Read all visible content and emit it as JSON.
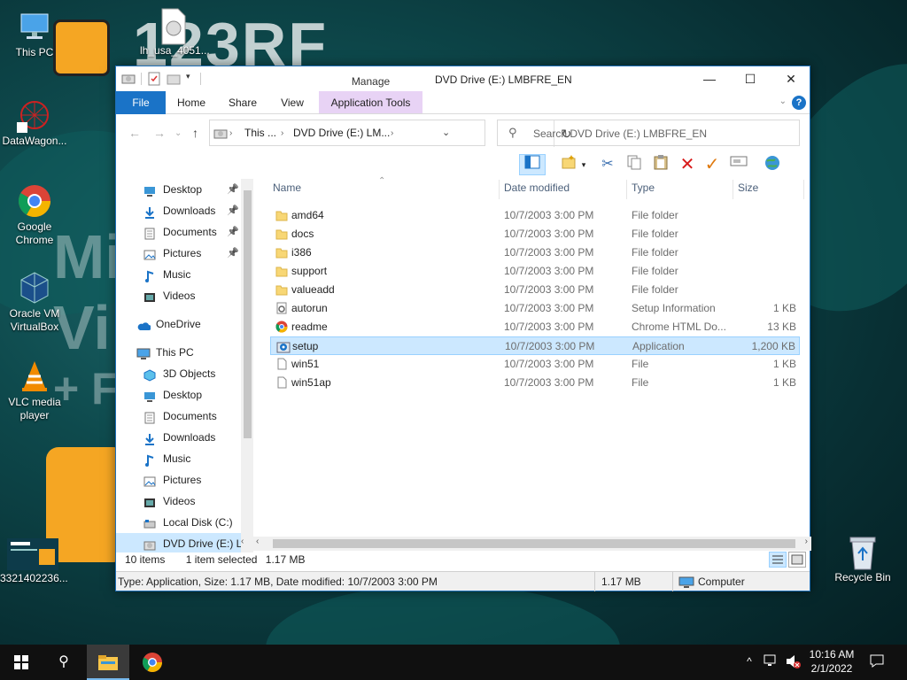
{
  "desktop": {
    "icons": [
      {
        "label": "This PC"
      },
      {
        "label": "lh_usa_4051..."
      },
      {
        "label": "DataWagon..."
      },
      {
        "label": "Google Chrome"
      },
      {
        "label": "Oracle VM VirtualBox"
      },
      {
        "label": "VLC media player"
      },
      {
        "label": "3321402236..."
      },
      {
        "label": "Recycle Bin"
      }
    ]
  },
  "window": {
    "title": "DVD Drive (E:) LMBFRE_EN",
    "context_tab_group": "Manage",
    "ribbon_tabs": [
      "File",
      "Home",
      "Share",
      "View",
      "Application Tools"
    ],
    "controls": {
      "minimize": "—",
      "maximize": "☐",
      "close": "✕"
    },
    "help": "?"
  },
  "address": {
    "crumbs": [
      "This ...",
      "DVD Drive (E:) LM..."
    ],
    "search_placeholder": "Search DVD Drive (E:) LMBFRE_EN"
  },
  "nav_pane": {
    "quick_access": [
      {
        "label": "Desktop",
        "pinned": true
      },
      {
        "label": "Downloads",
        "pinned": true
      },
      {
        "label": "Documents",
        "pinned": true
      },
      {
        "label": "Pictures",
        "pinned": true
      },
      {
        "label": "Music",
        "pinned": false
      },
      {
        "label": "Videos",
        "pinned": false
      }
    ],
    "onedrive": "OneDrive",
    "this_pc": "This PC",
    "this_pc_items": [
      "3D Objects",
      "Desktop",
      "Documents",
      "Downloads",
      "Music",
      "Pictures",
      "Videos",
      "Local Disk (C:)",
      "DVD Drive (E:) LM"
    ]
  },
  "columns": [
    "Name",
    "Date modified",
    "Type",
    "Size"
  ],
  "files": [
    {
      "name": "amd64",
      "date": "10/7/2003 3:00 PM",
      "type": "File folder",
      "size": "",
      "icon": "folder-icon"
    },
    {
      "name": "docs",
      "date": "10/7/2003 3:00 PM",
      "type": "File folder",
      "size": "",
      "icon": "folder-icon"
    },
    {
      "name": "i386",
      "date": "10/7/2003 3:00 PM",
      "type": "File folder",
      "size": "",
      "icon": "folder-icon"
    },
    {
      "name": "support",
      "date": "10/7/2003 3:00 PM",
      "type": "File folder",
      "size": "",
      "icon": "folder-icon"
    },
    {
      "name": "valueadd",
      "date": "10/7/2003 3:00 PM",
      "type": "File folder",
      "size": "",
      "icon": "folder-icon"
    },
    {
      "name": "autorun",
      "date": "10/7/2003 3:00 PM",
      "type": "Setup Information",
      "size": "1 KB",
      "icon": "settings-file-icon"
    },
    {
      "name": "readme",
      "date": "10/7/2003 3:00 PM",
      "type": "Chrome HTML Do...",
      "size": "13 KB",
      "icon": "chrome-icon"
    },
    {
      "name": "setup",
      "date": "10/7/2003 3:00 PM",
      "type": "Application",
      "size": "1,200 KB",
      "icon": "setup-app-icon"
    },
    {
      "name": "win51",
      "date": "10/7/2003 3:00 PM",
      "type": "File",
      "size": "1 KB",
      "icon": "blank-file-icon"
    },
    {
      "name": "win51ap",
      "date": "10/7/2003 3:00 PM",
      "type": "File",
      "size": "1 KB",
      "icon": "blank-file-icon"
    }
  ],
  "status": {
    "item_count": "10 items",
    "selection": "1 item selected",
    "selection_size": "1.17 MB",
    "details": "Type: Application, Size: 1.17 MB, Date modified: 10/7/2003 3:00 PM",
    "size": "1.17 MB",
    "location": "Computer"
  },
  "taskbar": {
    "time": "10:16 AM",
    "date": "2/1/2022"
  },
  "colors": {
    "accent": "#1a73c7",
    "manage_tab": "#e8d3f5",
    "selection": "#cce8ff"
  }
}
